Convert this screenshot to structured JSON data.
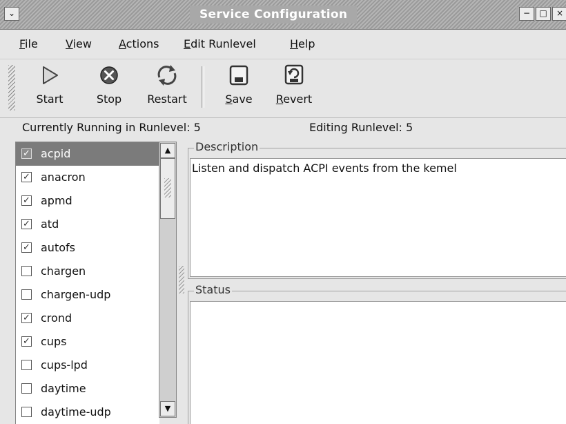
{
  "window": {
    "title": "Service Configuration"
  },
  "menubar": {
    "items": [
      {
        "mnemonic": "F",
        "rest": "ile"
      },
      {
        "mnemonic": "V",
        "rest": "iew"
      },
      {
        "mnemonic": "A",
        "rest": "ctions"
      },
      {
        "mnemonic": "E",
        "rest": "dit Runlevel"
      },
      {
        "mnemonic": "H",
        "rest": "elp"
      }
    ]
  },
  "toolbar": {
    "start_label": "Start",
    "stop_label": "Stop",
    "restart_label": "Restart",
    "save_mnemonic": "S",
    "save_rest": "ave",
    "revert_mnemonic": "R",
    "revert_rest": "evert"
  },
  "status": {
    "current_runlevel": "Currently Running in Runlevel: 5",
    "editing_runlevel": "Editing Runlevel: 5"
  },
  "services": {
    "items": [
      {
        "name": "acpid",
        "checked": true,
        "selected": true
      },
      {
        "name": "anacron",
        "checked": true
      },
      {
        "name": "apmd",
        "checked": true
      },
      {
        "name": "atd",
        "checked": true
      },
      {
        "name": "autofs",
        "checked": true
      },
      {
        "name": "chargen",
        "checked": false
      },
      {
        "name": "chargen-udp",
        "checked": false
      },
      {
        "name": "crond",
        "checked": true
      },
      {
        "name": "cups",
        "checked": true
      },
      {
        "name": "cups-lpd",
        "checked": false
      },
      {
        "name": "daytime",
        "checked": false
      },
      {
        "name": "daytime-udp",
        "checked": false
      }
    ]
  },
  "description": {
    "legend": "Description",
    "text": "Listen and dispatch ACPI events from the kemel"
  },
  "status_panel": {
    "legend": "Status",
    "text": ""
  },
  "icons": {
    "start": "play-icon",
    "stop": "stop-icon",
    "restart": "restart-icon",
    "save": "save-icon",
    "revert": "revert-icon"
  }
}
